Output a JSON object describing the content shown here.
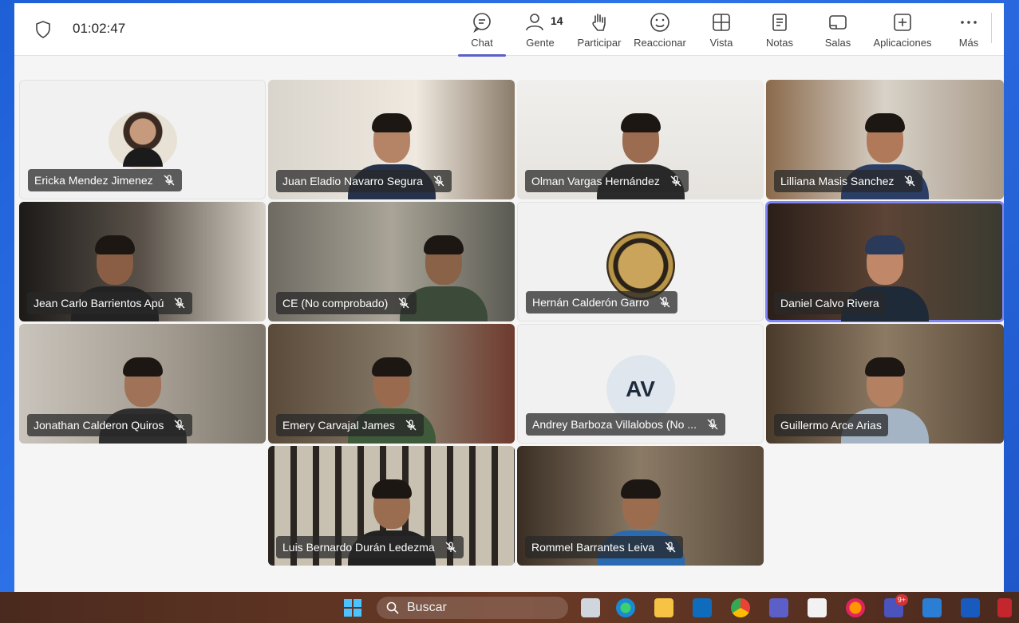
{
  "meeting": {
    "timer": "01:02:47"
  },
  "toolbar": {
    "chat": "Chat",
    "people": "Gente",
    "people_count": "14",
    "raise": "Participar",
    "react": "Reaccionar",
    "view": "Vista",
    "notes": "Notas",
    "rooms": "Salas",
    "apps": "Aplicaciones",
    "more": "Más"
  },
  "participants": [
    {
      "name": "Ericka Mendez Jimenez"
    },
    {
      "name": "Juan Eladio Navarro Segura"
    },
    {
      "name": "Olman Vargas Hernández"
    },
    {
      "name": "Lilliana Masis Sanchez"
    },
    {
      "name": "Jean Carlo Barrientos Apú"
    },
    {
      "name": "CE (No comprobado)"
    },
    {
      "name": "Hernán Calderón Garro"
    },
    {
      "name": "Daniel Calvo Rivera"
    },
    {
      "name": "Jonathan Calderon Quiros"
    },
    {
      "name": "Emery Carvajal James"
    },
    {
      "name": "Andrey Barboza Villalobos (No ...",
      "initials": "AV"
    },
    {
      "name": "Guillermo Arce Arias"
    },
    {
      "name": "Luis Bernardo Durán Ledezma"
    },
    {
      "name": "Rommel Barrantes Leiva"
    }
  ],
  "taskbar": {
    "search_label": "Buscar",
    "notification_badge": "9+"
  },
  "colors": {
    "accent": "#5b5fc7",
    "highlight": "#7f85f5",
    "desktop": "#2f73e8"
  }
}
